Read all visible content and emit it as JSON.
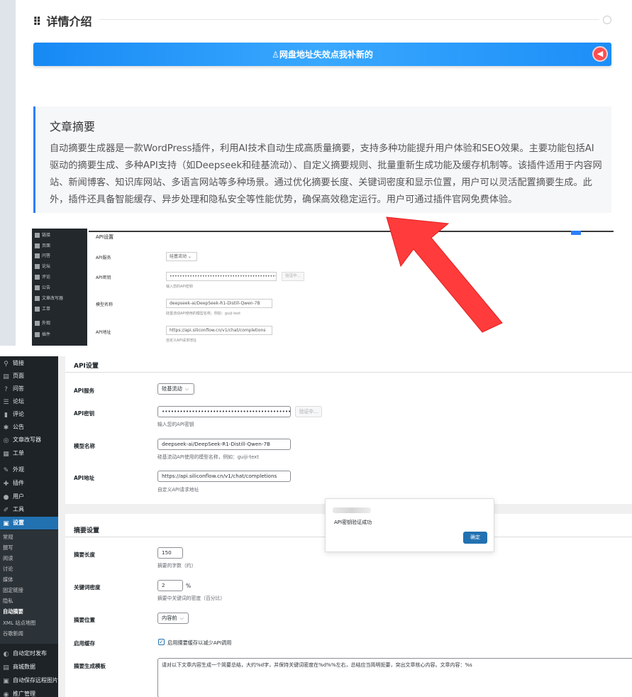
{
  "top": {
    "section_title": "详情介绍",
    "notice_bar": "网盘地址失效点我补新的",
    "summary": {
      "title": "文章摘要",
      "body": "自动摘要生成器是一款WordPress插件，利用AI技术自动生成高质量摘要，支持多种功能提升用户体验和SEO效果。主要功能包括AI驱动的摘要生成、多种API支持（如Deepseek和硅基流动）、自定义摘要规则、批量重新生成功能及缓存机制等。该插件适用于内容网站、新闻博客、知识库网站、多语言网站等多种场景。通过优化摘要长度、关键词密度和显示位置，用户可以灵活配置摘要生成。此外，插件还具备智能缓存、异步处理和隐私安全等性能优势，确保高效稳定运行。用户可通过插件官网免费体验。"
    },
    "mini": {
      "heading": "API设置",
      "sidebar": [
        "链接",
        "页面",
        "问答",
        "论坛",
        "评论",
        "公告",
        "文章改写器",
        "工单",
        "外观",
        "插件"
      ],
      "rows": [
        {
          "label": "API服务",
          "value": "硅基流动 ⌄"
        },
        {
          "label": "API密钥",
          "value": "••••••••••••••••••••••••••••••••••••••••••••••••••••",
          "help": "输入您的API密钥",
          "button": "验证中..."
        },
        {
          "label": "模型名称",
          "value": "deepseek-ai/DeepSeek-R1-Distill-Qwen-7B",
          "help": "硅基流动API使用的模型名称，例如：guiji-text"
        },
        {
          "label": "API地址",
          "value": "https://api.siliconflow.cn/v1/chat/completions",
          "help": "自定义API请求地址"
        }
      ]
    }
  },
  "sidebar": {
    "items": [
      {
        "icon": "link-icon",
        "glyph": "⚲",
        "label": "链接"
      },
      {
        "icon": "page-icon",
        "glyph": "▤",
        "label": "页面"
      },
      {
        "icon": "question-icon",
        "glyph": "?",
        "label": "问答"
      },
      {
        "icon": "forum-icon",
        "glyph": "☰",
        "label": "论坛"
      },
      {
        "icon": "comment-icon",
        "glyph": "▮",
        "label": "评论"
      },
      {
        "icon": "pin-icon",
        "glyph": "✱",
        "label": "公告"
      },
      {
        "icon": "rewrite-icon",
        "glyph": "◎",
        "label": "文章改写器"
      },
      {
        "icon": "ticket-icon",
        "glyph": "▦",
        "label": "工单"
      },
      {
        "icon": "appearance-icon",
        "glyph": "✎",
        "label": "外观"
      },
      {
        "icon": "plugin-icon",
        "glyph": "✚",
        "label": "插件"
      },
      {
        "icon": "user-icon",
        "glyph": "●",
        "label": "用户"
      },
      {
        "icon": "tool-icon",
        "glyph": "✐",
        "label": "工具"
      },
      {
        "icon": "settings-icon",
        "glyph": "▣",
        "label": "设置"
      }
    ],
    "submenu": [
      "常规",
      "撰写",
      "阅读",
      "讨论",
      "媒体",
      "固定链接",
      "隐私",
      "自动摘要",
      "XML 站点地图",
      "谷歌新闻"
    ],
    "bottom_items": [
      {
        "icon": "schedule-icon",
        "glyph": "◐",
        "label": "自动定时发布"
      },
      {
        "icon": "mall-icon",
        "glyph": "▤",
        "label": "商城数据"
      },
      {
        "icon": "image-icon",
        "glyph": "▣",
        "label": "自动保存远程图片"
      },
      {
        "icon": "promo-icon",
        "glyph": "◉",
        "label": "推广管理"
      }
    ]
  },
  "api": {
    "heading": "API设置",
    "service_label": "API服务",
    "service_value": "硅基流动",
    "key_label": "API密钥",
    "key_value": "•••••••••••••••••••••••••••••••••••••••••••••••••••",
    "key_help": "输入您的API密钥",
    "verify_button": "验证中...",
    "model_label": "模型名称",
    "model_value": "deepseek-ai/DeepSeek-R1-Distill-Qwen-7B",
    "model_help": "硅基流动API使用的模型名称，例如：guiji-text",
    "url_label": "API地址",
    "url_value": "https://api.siliconflow.cn/v1/chat/completions",
    "url_help": "自定义API请求地址"
  },
  "summary_settings": {
    "heading": "摘要设置",
    "length_label": "摘要长度",
    "length_value": "150",
    "length_help": "摘要的字数（约）",
    "density_label": "关键词密度",
    "density_value": "2",
    "density_unit": "%",
    "density_help": "摘要中关键词的密度（百分比）",
    "position_label": "摘要位置",
    "position_value": "内容前",
    "cache_label": "启用缓存",
    "cache_text": "启用摘要缓存以减少API调用",
    "template_label": "摘要生成模板",
    "template_value": "请对以下文章内容生成一个简要总结，大约%d字，并保持关键词密度在%d%%左右，总结应当简明扼要，突出文章核心内容。文章内容：%s"
  },
  "dialog": {
    "message": "API密钥验证成功",
    "ok": "确定"
  },
  "colors": {
    "accent": "#2271b1",
    "sidebar_bg": "#1d2327",
    "notice_blue": "#1789f4",
    "arrow_red": "#ff3b3b"
  }
}
